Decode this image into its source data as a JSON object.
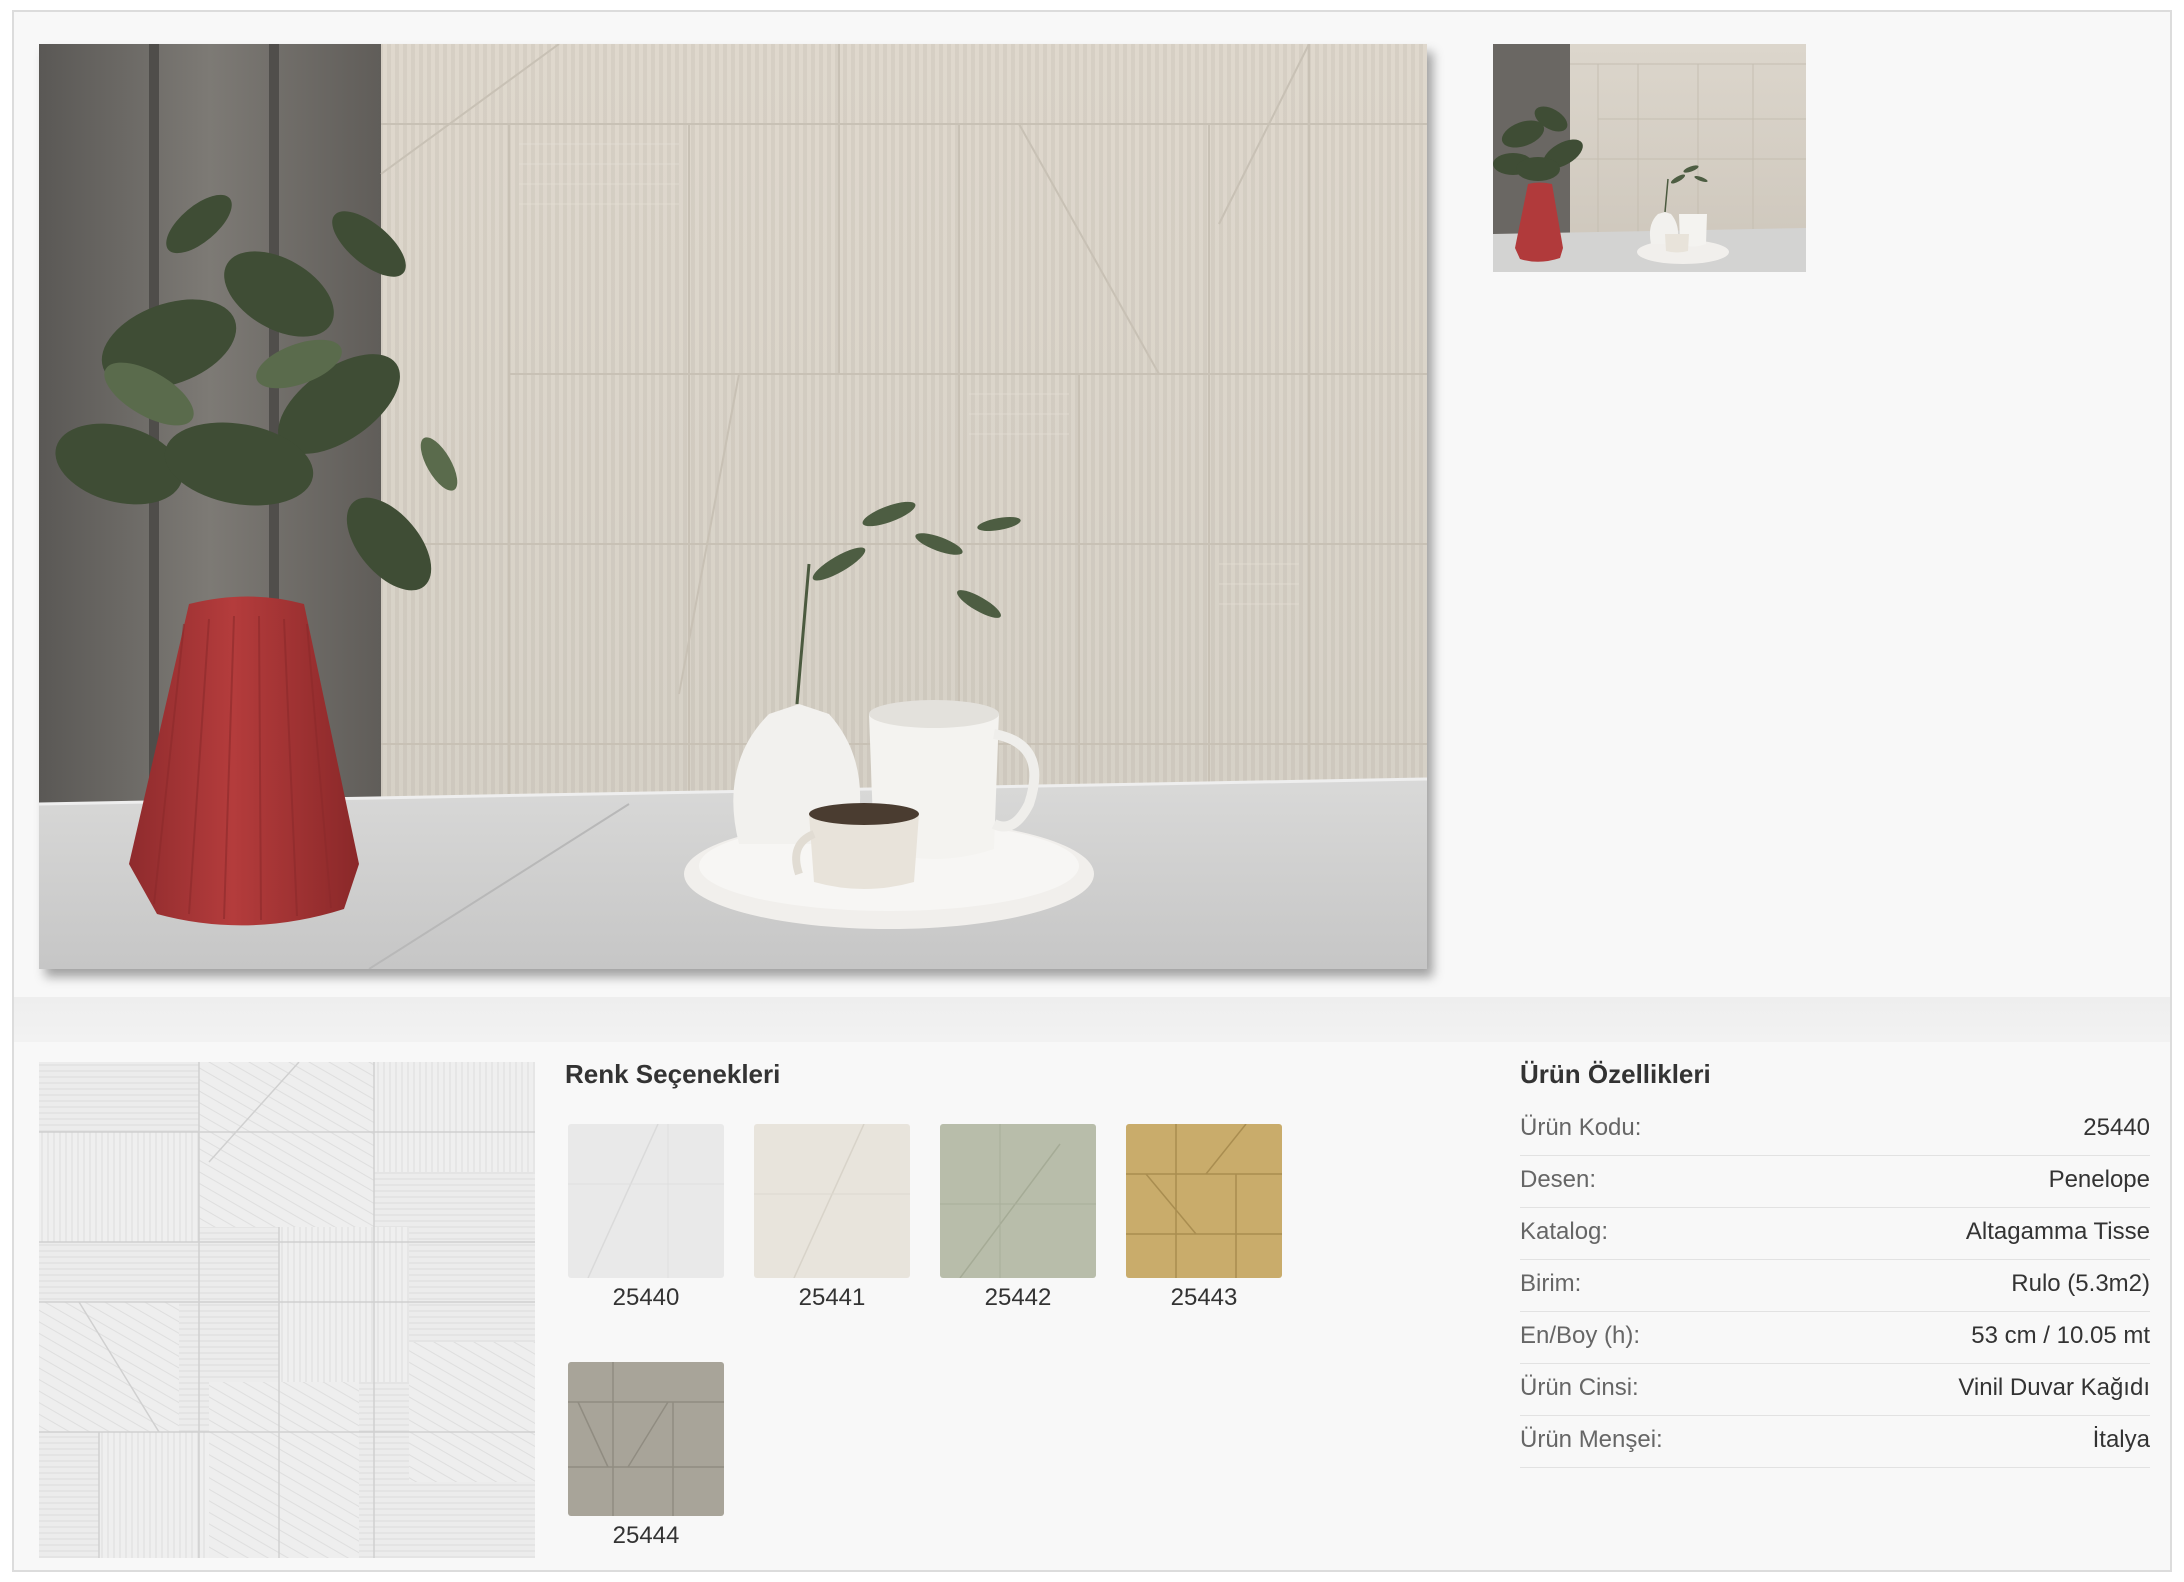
{
  "colors": {
    "accent_vase": "#b13a3b",
    "wall": "#d9d2c7",
    "swatches": [
      "#e8e8e8",
      "#e8e4dc",
      "#b6bca8",
      "#c8ab6a",
      "#a7a398"
    ]
  },
  "gallery": {
    "main_image_icon": "room-scene-image",
    "thumbnail_icon": "room-scene-thumbnail"
  },
  "color_options": {
    "title": "Renk Seçenekleri",
    "items": [
      {
        "code": "25440",
        "color": "#e8e8e8"
      },
      {
        "code": "25441",
        "color": "#e8e4dc"
      },
      {
        "code": "25442",
        "color": "#b6bca8"
      },
      {
        "code": "25443",
        "color": "#c8ab6a"
      },
      {
        "code": "25444",
        "color": "#a7a398"
      }
    ]
  },
  "specs": {
    "title": "Ürün Özellikleri",
    "rows": [
      {
        "label": "Ürün Kodu:",
        "value": "25440"
      },
      {
        "label": "Desen:",
        "value": "Penelope"
      },
      {
        "label": "Katalog:",
        "value": "Altagamma Tisse"
      },
      {
        "label": "Birim:",
        "value": "Rulo (5.3m2)"
      },
      {
        "label": "En/Boy (h):",
        "value": "53 cm / 10.05 mt"
      },
      {
        "label": "Ürün Cinsi:",
        "value": "Vinil Duvar Kağıdı"
      },
      {
        "label": "Ürün Menşei:",
        "value": "İtalya"
      }
    ]
  }
}
